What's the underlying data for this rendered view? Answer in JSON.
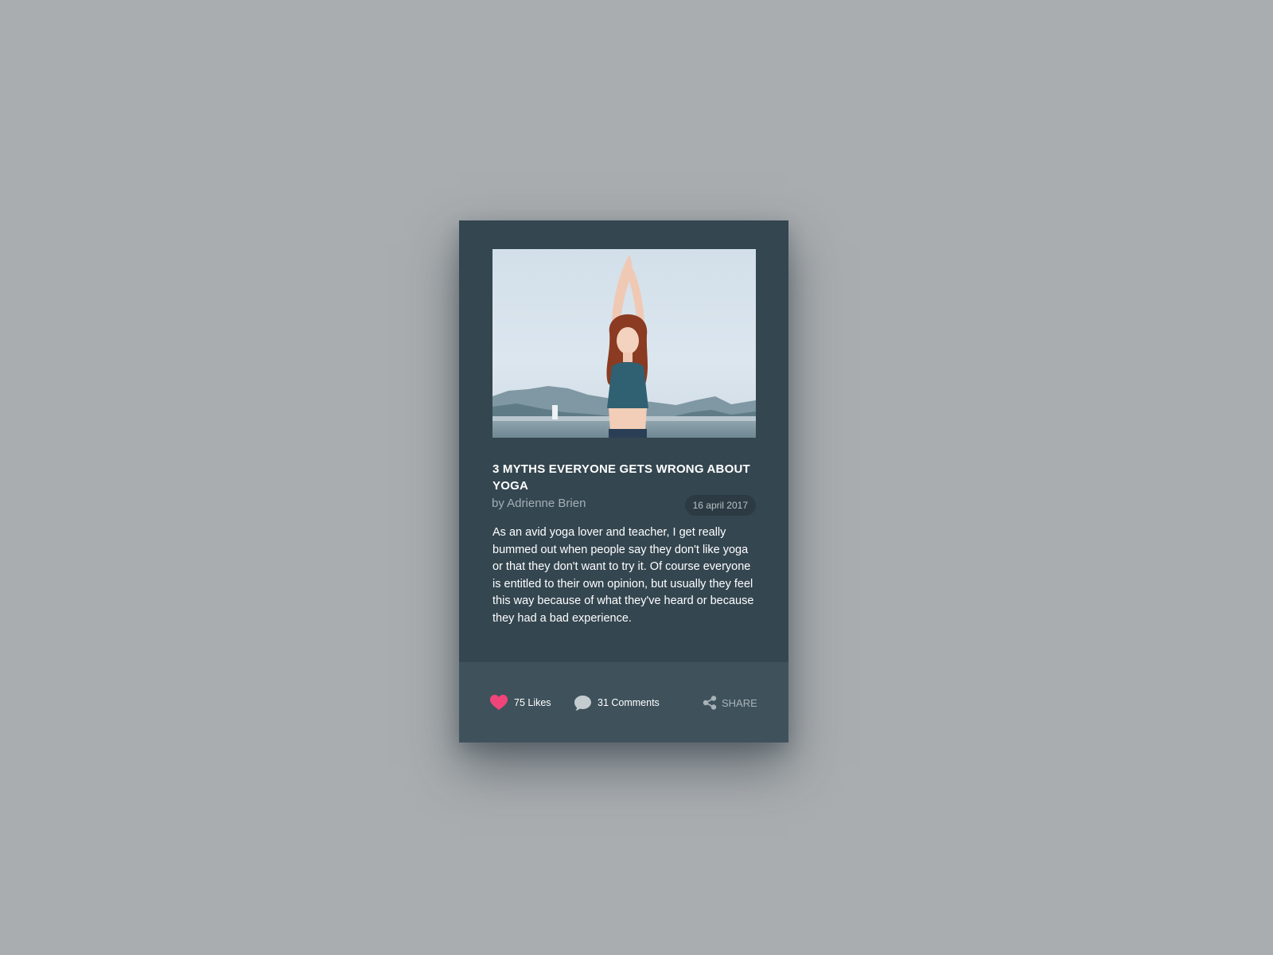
{
  "post": {
    "title": "3 MYTHS EVERYONE GETS WRONG ABOUT YOGA",
    "author": "by Adrienne Brien",
    "date": "16 april 2017",
    "excerpt": "As an avid yoga lover and teacher, I get really bummed out when people say they don't like yoga or that they don't want to try it. Of course everyone is entitled to their own opinion, but usually they feel this way because of what they've heard or because they had a bad experience."
  },
  "actions": {
    "likes_label": "75 Likes",
    "comments_label": "31 Comments",
    "share_label": "SHARE"
  },
  "icons": {
    "like": "heart-icon",
    "comment": "comment-bubble-icon",
    "share": "share-icon"
  },
  "colors": {
    "page_background": "#a9adb0",
    "card_background": "#344650",
    "footer_background": "#3f525c",
    "heart": "#f0457a",
    "muted_text": "#a4afb6"
  }
}
